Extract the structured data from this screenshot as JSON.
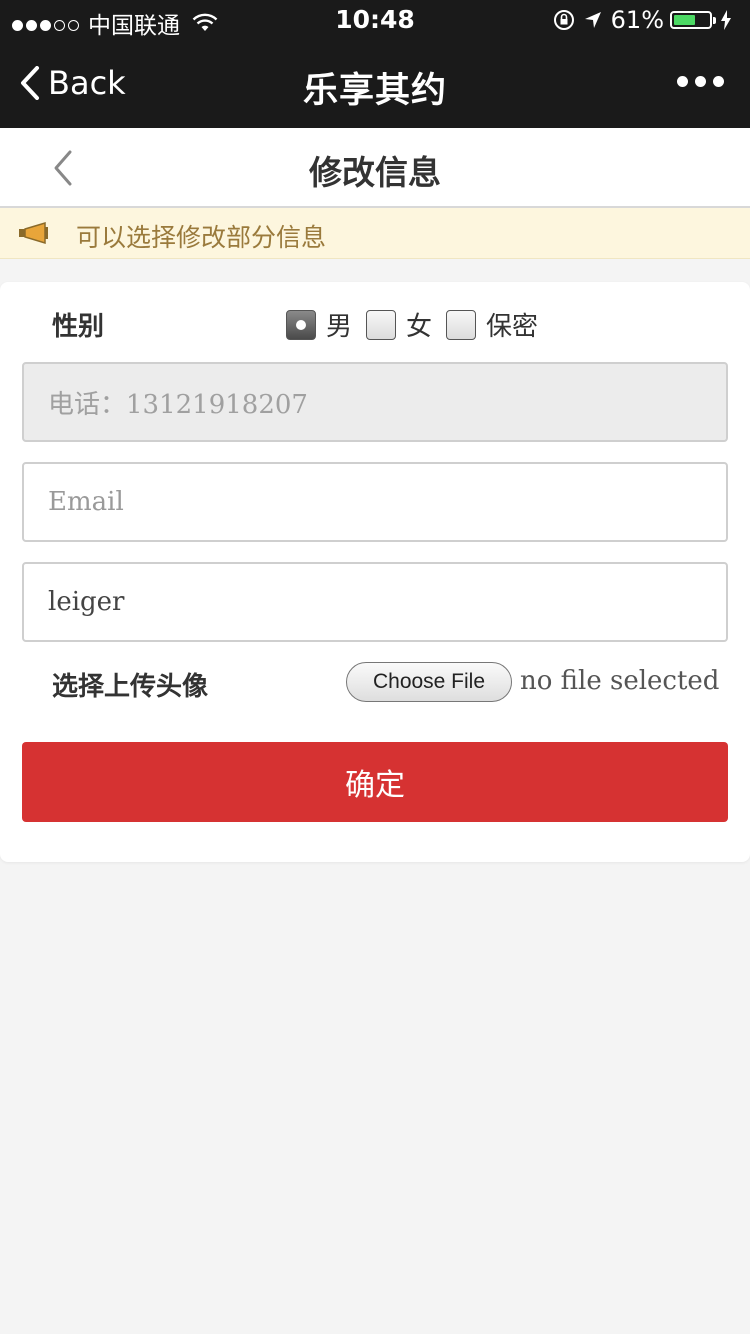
{
  "status_bar": {
    "carrier": "中国联通",
    "time": "10:48",
    "battery_percent": "61%",
    "battery_level": 0.61,
    "battery_color": "#4cd964"
  },
  "nav": {
    "back_label": "Back",
    "title": "乐享其约"
  },
  "page": {
    "title": "修改信息"
  },
  "notice": {
    "text": "可以选择修改部分信息"
  },
  "form": {
    "gender_label": "性别",
    "gender_options": [
      "男",
      "女",
      "保密"
    ],
    "gender_selected": "男",
    "phone_value": "电话：13121918207",
    "email_placeholder": "Email",
    "email_value": "",
    "name_value": "leiger",
    "upload_label": "选择上传头像",
    "choose_file_label": "Choose File",
    "no_file_text": "no file selected",
    "submit_label": "确定"
  },
  "colors": {
    "nav_bg": "#1a1a1a",
    "accent": "#d63232",
    "notice_bg": "#fdf6de",
    "notice_text": "#9a7a3c"
  }
}
